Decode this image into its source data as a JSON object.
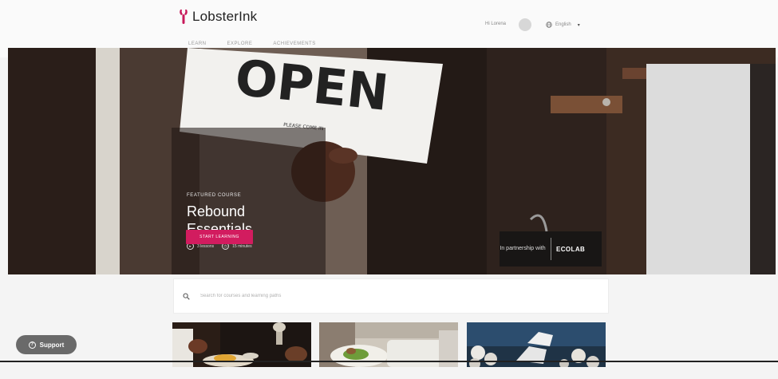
{
  "header": {
    "logo_text": "LobsterInk",
    "tabs": [
      {
        "label": "Learn",
        "active": false
      },
      {
        "label": "Explore",
        "active": true
      },
      {
        "label": "Achievements",
        "active": false
      }
    ],
    "greeting": "Hi Lorena",
    "language": "English"
  },
  "hero": {
    "sign_text": "OPEN",
    "sign_subtext": "PLEASE COME IN",
    "featured_label": "Featured Course",
    "title": "Rebound Essentials",
    "lessons": "3 lessons",
    "duration": "15 minutes",
    "cta_label": "Start Learning",
    "partner_text": "In partnership with",
    "partner_logo": "ECOLAB"
  },
  "search": {
    "placeholder": "Search for courses and learning paths"
  },
  "support": {
    "label": "Support"
  },
  "colors": {
    "accent": "#19a7a0",
    "cta": "#d21c5f",
    "logo_icon": "#c8195a"
  },
  "icons": [
    "lobster-icon",
    "globe-icon",
    "chevron-down-icon",
    "play-icon",
    "clock-icon",
    "search-icon",
    "question-icon"
  ]
}
